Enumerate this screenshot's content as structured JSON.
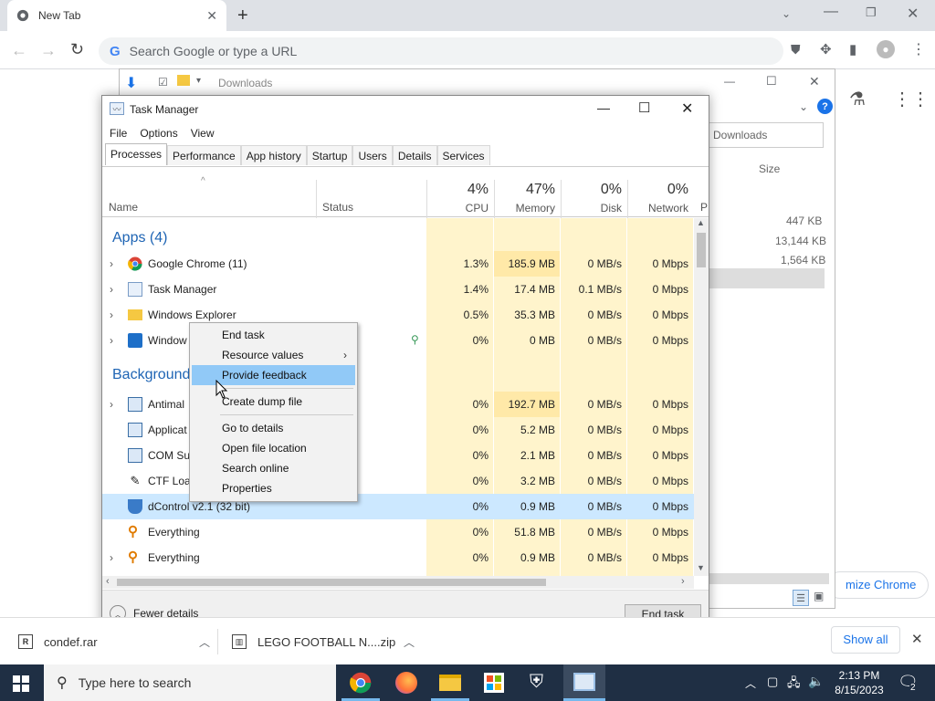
{
  "chrome": {
    "tab_title": "New Tab",
    "omnibox_placeholder": "Search Google or type a URL",
    "customize_label": "mize Chrome"
  },
  "explorer": {
    "title": "Downloads",
    "path_box": "Downloads",
    "size_header": "Size",
    "sizes": [
      "447 KB",
      "13,144 KB",
      "1,564 KB"
    ]
  },
  "taskmgr": {
    "title": "Task Manager",
    "menu": [
      "File",
      "Options",
      "View"
    ],
    "tabs": [
      "Processes",
      "Performance",
      "App history",
      "Startup",
      "Users",
      "Details",
      "Services"
    ],
    "columns": {
      "name": "Name",
      "status": "Status",
      "cpu_pct": "4%",
      "cpu": "CPU",
      "mem_pct": "47%",
      "mem": "Memory",
      "disk_pct": "0%",
      "disk": "Disk",
      "net_pct": "0%",
      "net": "Network",
      "p": "P"
    },
    "groups": {
      "apps": "Apps (4)",
      "background": "Background"
    },
    "rows": [
      {
        "name": "Google Chrome (11)",
        "cpu": "1.3%",
        "mem": "185.9 MB",
        "disk": "0 MB/s",
        "net": "0 Mbps"
      },
      {
        "name": "Task Manager",
        "cpu": "1.4%",
        "mem": "17.4 MB",
        "disk": "0.1 MB/s",
        "net": "0 Mbps"
      },
      {
        "name": "Windows Explorer",
        "cpu": "0.5%",
        "mem": "35.3 MB",
        "disk": "0 MB/s",
        "net": "0 Mbps"
      },
      {
        "name": "Window",
        "cpu": "0%",
        "mem": "0 MB",
        "disk": "0 MB/s",
        "net": "0 Mbps"
      },
      {
        "name": "Antimal",
        "cpu": "0%",
        "mem": "192.7 MB",
        "disk": "0 MB/s",
        "net": "0 Mbps"
      },
      {
        "name": "Applicat",
        "cpu": "0%",
        "mem": "5.2 MB",
        "disk": "0 MB/s",
        "net": "0 Mbps"
      },
      {
        "name": "COM Su",
        "cpu": "0%",
        "mem": "2.1 MB",
        "disk": "0 MB/s",
        "net": "0 Mbps"
      },
      {
        "name": "CTF Loa",
        "cpu": "0%",
        "mem": "3.2 MB",
        "disk": "0 MB/s",
        "net": "0 Mbps"
      },
      {
        "name": "dControl v2.1 (32 bit)",
        "cpu": "0%",
        "mem": "0.9 MB",
        "disk": "0 MB/s",
        "net": "0 Mbps"
      },
      {
        "name": "Everything",
        "cpu": "0%",
        "mem": "51.8 MB",
        "disk": "0 MB/s",
        "net": "0 Mbps"
      },
      {
        "name": "Everything",
        "cpu": "0%",
        "mem": "0.9 MB",
        "disk": "0 MB/s",
        "net": "0 Mbps"
      }
    ],
    "fewer_details": "Fewer details",
    "end_task": "End task"
  },
  "context_menu": {
    "items": [
      "End task",
      "Resource values",
      "Provide feedback",
      "Create dump file",
      "Go to details",
      "Open file location",
      "Search online",
      "Properties"
    ]
  },
  "downloads": {
    "items": [
      "condef.rar",
      "LEGO FOOTBALL N....zip"
    ],
    "show_all": "Show all"
  },
  "taskbar": {
    "search_placeholder": "Type here to search",
    "time": "2:13 PM",
    "date": "8/15/2023",
    "notif_count": "2"
  }
}
